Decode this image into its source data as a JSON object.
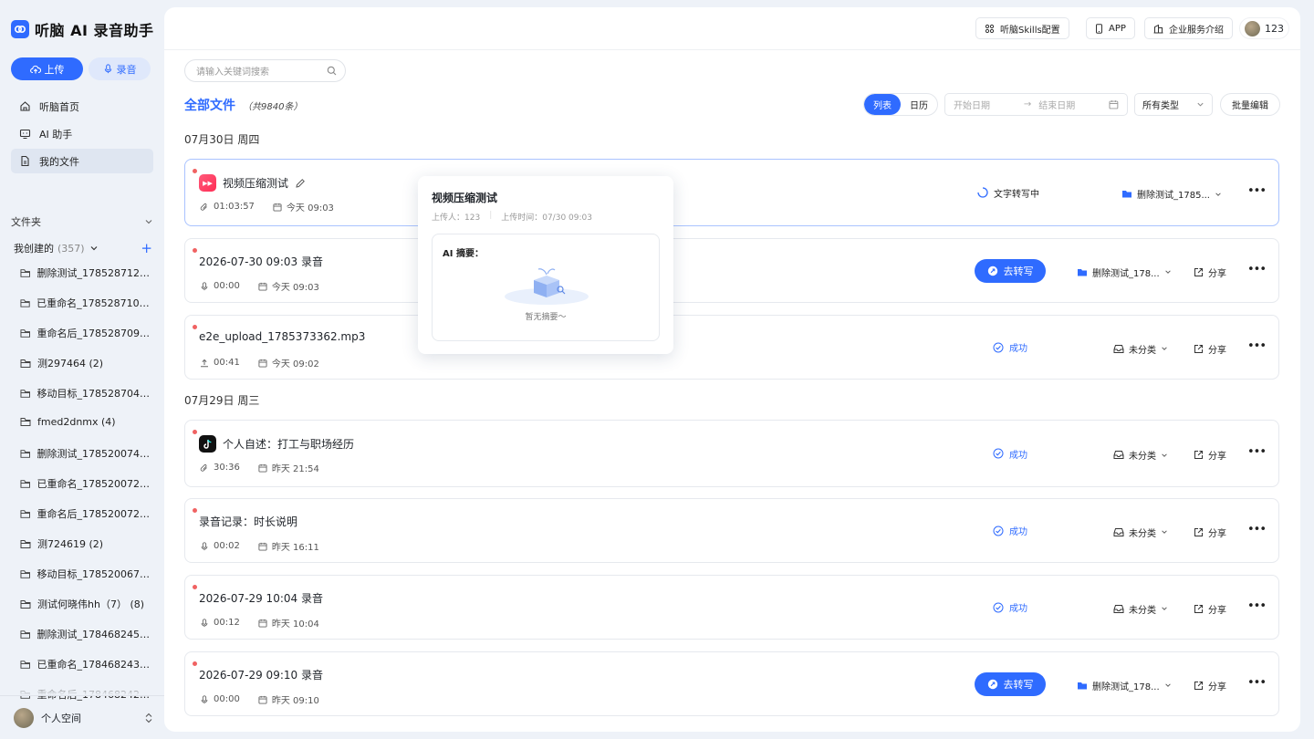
{
  "app": {
    "logo_text": "听脑 AI 录音助手"
  },
  "sidebar": {
    "upload_label": "上传",
    "record_label": "录音",
    "nav": [
      {
        "label": "听脑首页"
      },
      {
        "label": "AI 助手"
      },
      {
        "label": "我的文件"
      }
    ],
    "folder_section": "文件夹",
    "created_label": "我创建的",
    "created_count": "(357)",
    "folders": [
      "删除测试_1785287120 ...",
      "已重命名_1785287107 (...",
      "重命名后_1785287096 ...",
      "测297464 (2)",
      "移动目标_1785287046 ...",
      "fmed2dnmx (4)",
      "删除测试_1785200743 ...",
      "已重命名_1785200729 ...",
      "重命名后_1785200720 ...",
      "测724619 (2)",
      "移动目标_1785200673 ...",
      "测试何晓伟hh（7） (8)",
      "删除测试_1784682455 ...",
      "已重命名_1784682438 ...",
      "重命名后_1784682426 ..."
    ],
    "space_label": "个人空间"
  },
  "topbar": {
    "skills_label": "听脑Skills配置",
    "app_label": "APP",
    "enterprise_label": "企业服务介绍",
    "user_name": "123"
  },
  "toolbar": {
    "search_placeholder": "请输入关键词搜索",
    "title": "全部文件",
    "total": "（共9840条）",
    "view_list": "列表",
    "view_calendar": "日历",
    "start_date": "开始日期",
    "end_date": "结束日期",
    "type_select": "所有类型",
    "bulk_edit": "批量编辑"
  },
  "groups": [
    {
      "date": "07月30日 周四"
    },
    {
      "date": "07月29日 周三"
    }
  ],
  "files": [
    {
      "name": "视频压缩测试",
      "duration": "01:03:57",
      "time": "今天 09:03",
      "status": "文字转写中",
      "category": "删除测试_1785...",
      "share": ""
    },
    {
      "name": "2026-07-30 09:03 录音",
      "duration": "00:00",
      "time": "今天 09:03",
      "action": "去转写",
      "category": "删除测试_178...",
      "share": "分享"
    },
    {
      "name": "e2e_upload_1785373362.mp3",
      "duration": "00:41",
      "time": "今天 09:02",
      "status": "成功",
      "category": "未分类",
      "share": "分享"
    },
    {
      "name": "个人自述：打工与职场经历",
      "duration": "30:36",
      "time": "昨天 21:54",
      "status": "成功",
      "category": "未分类",
      "share": "分享"
    },
    {
      "name": "录音记录：时长说明",
      "duration": "00:02",
      "time": "昨天 16:11",
      "status": "成功",
      "category": "未分类",
      "share": "分享"
    },
    {
      "name": "2026-07-29 10:04 录音",
      "duration": "00:12",
      "time": "昨天 10:04",
      "status": "成功",
      "category": "未分类",
      "share": "分享"
    },
    {
      "name": "2026-07-29 09:10 录音",
      "duration": "00:00",
      "time": "昨天 09:10",
      "action": "去转写",
      "category": "删除测试_178...",
      "share": "分享"
    }
  ],
  "popup": {
    "title": "视频压缩测试",
    "uploader": "上传人：123",
    "upload_time": "上传时间：07/30 09:03",
    "summary_label": "AI 摘要：",
    "empty_text": "暂无摘要～"
  },
  "colors": {
    "accent": "#2f6bff",
    "unread_dot": "#f06262",
    "background": "#eef2f8"
  }
}
